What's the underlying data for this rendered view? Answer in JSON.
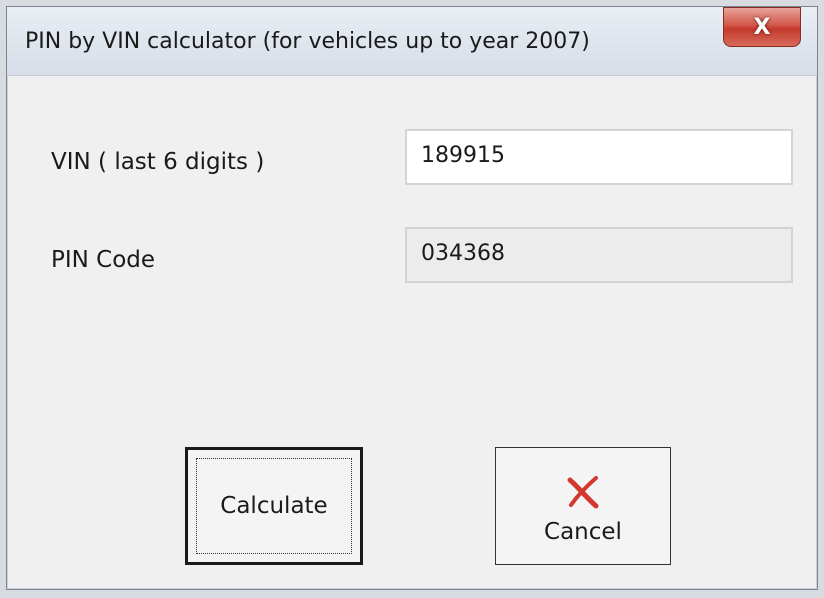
{
  "window": {
    "title": "PIN by VIN calculator (for vehicles up to year 2007)",
    "close_glyph": "X"
  },
  "form": {
    "vin_label": "VIN ( last 6 digits )",
    "vin_value": "189915",
    "pin_label": "PIN Code",
    "pin_value": "034368"
  },
  "buttons": {
    "calculate_label": "Calculate",
    "cancel_label": "Cancel",
    "cancel_icon": "red-x-icon"
  },
  "colors": {
    "close_button": "#c43a2c",
    "cancel_icon": "#d2382e"
  }
}
